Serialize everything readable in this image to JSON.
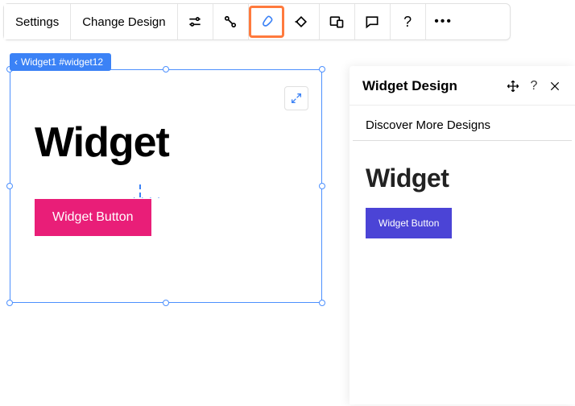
{
  "toolbar": {
    "settings_label": "Settings",
    "change_design_label": "Change Design"
  },
  "breadcrumb": {
    "label": "Widget1 #widget12"
  },
  "canvas": {
    "widget_title": "Widget",
    "widget_button_label": "Widget Button"
  },
  "panel": {
    "title": "Widget Design",
    "subheading": "Discover More Designs",
    "preview_title": "Widget",
    "preview_button_label": "Widget Button"
  }
}
